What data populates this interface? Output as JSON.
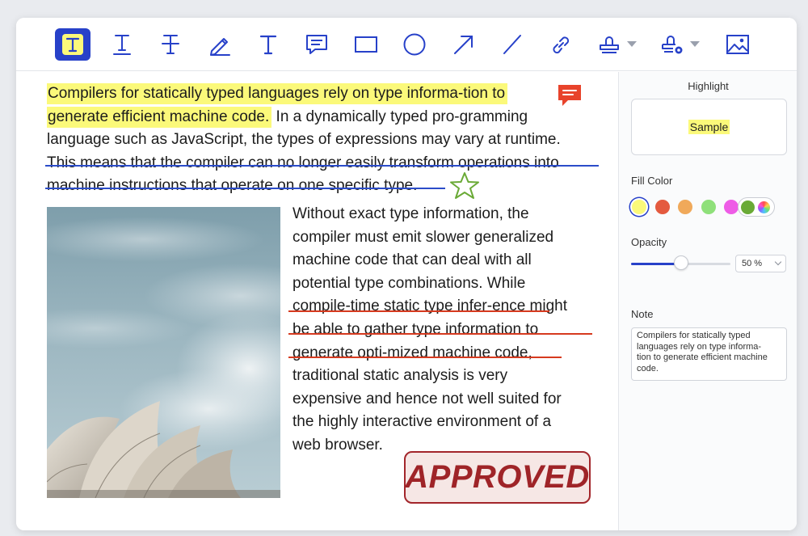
{
  "toolbar": {
    "tools": [
      {
        "name": "highlight-text",
        "icon": "highlight-text-icon",
        "active": true
      },
      {
        "name": "underline-text",
        "icon": "underline-text-icon"
      },
      {
        "name": "strikethrough-text",
        "icon": "strikethrough-text-icon"
      },
      {
        "name": "pencil",
        "icon": "pencil-icon"
      },
      {
        "name": "text",
        "icon": "text-icon"
      },
      {
        "name": "comment",
        "icon": "comment-icon"
      },
      {
        "name": "rectangle",
        "icon": "rectangle-icon"
      },
      {
        "name": "ellipse",
        "icon": "ellipse-icon"
      },
      {
        "name": "arrow",
        "icon": "arrow-icon"
      },
      {
        "name": "line",
        "icon": "line-icon"
      },
      {
        "name": "link",
        "icon": "link-icon"
      },
      {
        "name": "stamp",
        "icon": "stamp-icon"
      },
      {
        "name": "signature",
        "icon": "signature-icon"
      },
      {
        "name": "image",
        "icon": "image-icon"
      }
    ],
    "accent_color": "#2741c9",
    "active_fill": "#fbf97a"
  },
  "document": {
    "highlight_line_1": "Compilers for statically typed languages rely on type informa-tion to",
    "highlight_line_2": "generate efficient machine code.",
    "line_2_rest": " In a dynamically typed pro-gramming",
    "line_3": "language such as JavaScript, the types of expressions may vary at runtime.",
    "strike_line_1": "This means that the compiler can no longer easily transform operations into",
    "strike_line_2": "machine instructions that operate on one specific type.",
    "column_lines": [
      "Without exact type information, the",
      "compiler must emit slower generalized",
      "machine code that can deal with all",
      "potential type combinations. While",
      "compile-time static type infer-ence might",
      "be able to gather type information to",
      "generate opti-mized machine code,",
      "traditional static analysis is very",
      "expensive and hence not well suited for",
      "the highly interactive environment of a",
      "web browser."
    ],
    "stamp_text": "APPROVED",
    "colors": {
      "highlight": "#fbf97a",
      "strikethrough": "#2b4cc9",
      "underline": "#d63a1f",
      "comment": "#e8432b",
      "star": "#6aaa36",
      "stamp": "#9f2428"
    }
  },
  "panel": {
    "title": "Highlight",
    "preview_text": "Sample",
    "fill_color_label": "Fill Color",
    "swatches": [
      "#fbf97a",
      "#e45a3f",
      "#f0a95a",
      "#8fe07a",
      "#ee5ce6"
    ],
    "selected_swatch": "#fbf97a",
    "opacity_label": "Opacity",
    "opacity_value": "50 %",
    "opacity_fraction": 0.5,
    "note_label": "Note",
    "note_lines": [
      "Compilers for statically typed",
      "languages rely on type informa-",
      "tion to generate efficient machine",
      "code."
    ]
  }
}
